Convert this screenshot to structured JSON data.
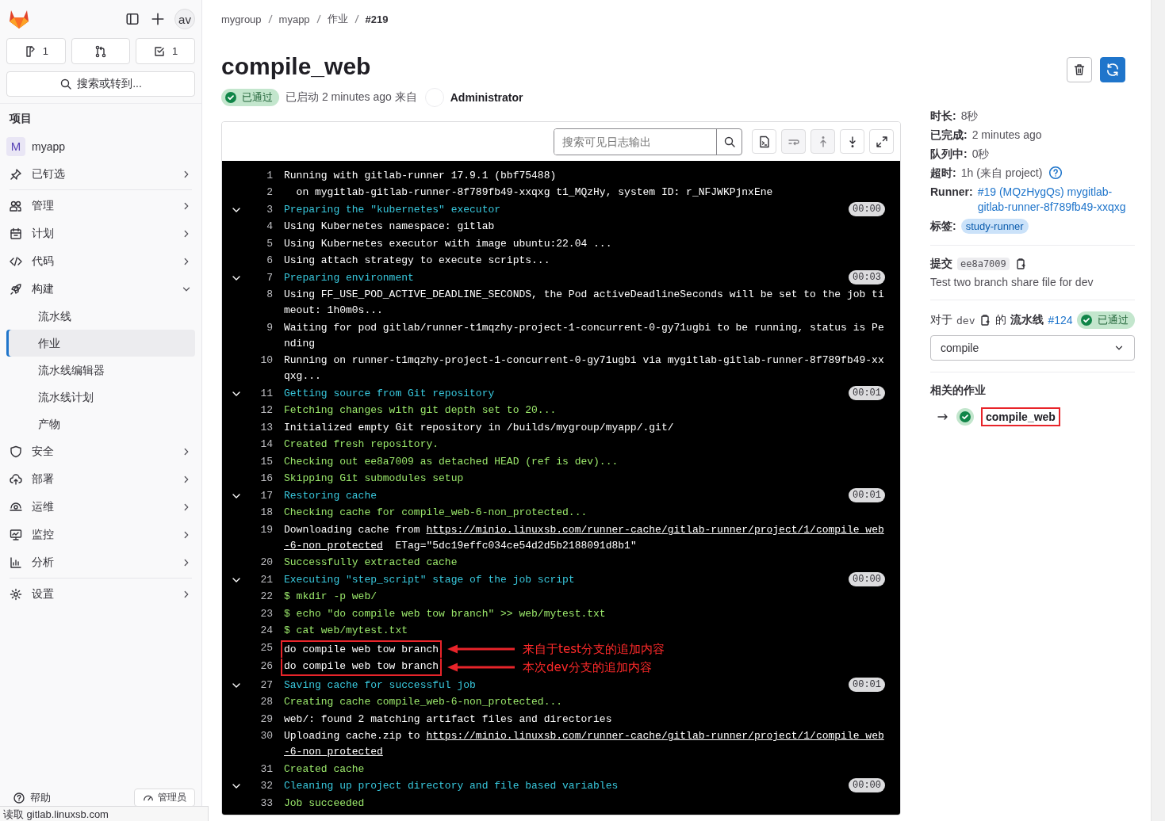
{
  "sidebar": {
    "avatar": "av",
    "counters": [
      {
        "kind": "issues",
        "count": "1"
      },
      {
        "kind": "merge_requests"
      },
      {
        "kind": "todos",
        "count": "1"
      }
    ],
    "search": "搜索或转到...",
    "section_title": "项目",
    "items": [
      {
        "kind": "project",
        "initial": "M",
        "label": "myapp"
      },
      {
        "kind": "menu",
        "label": "已钉选",
        "expanded": false
      },
      {
        "kind": "menu",
        "label": "管理",
        "expanded": false
      },
      {
        "kind": "menu",
        "label": "计划",
        "expanded": false
      },
      {
        "kind": "menu",
        "label": "代码",
        "expanded": false
      },
      {
        "kind": "menu",
        "label": "构建",
        "expanded": true,
        "children": [
          {
            "label": "流水线",
            "selected": false
          },
          {
            "label": "作业",
            "selected": true
          },
          {
            "label": "流水线编辑器",
            "selected": false
          },
          {
            "label": "流水线计划",
            "selected": false
          },
          {
            "label": "产物",
            "selected": false
          }
        ]
      },
      {
        "kind": "menu",
        "label": "安全",
        "expanded": false
      },
      {
        "kind": "menu",
        "label": "部署",
        "expanded": false
      },
      {
        "kind": "menu",
        "label": "运维",
        "expanded": false
      },
      {
        "kind": "menu",
        "label": "监控",
        "expanded": false
      },
      {
        "kind": "menu",
        "label": "分析",
        "expanded": false
      },
      {
        "kind": "menu",
        "label": "设置",
        "expanded": false
      }
    ],
    "help": "帮助",
    "admin": "管理员"
  },
  "breadcrumb": [
    "mygroup",
    "myapp",
    "作业",
    "#219"
  ],
  "job": {
    "title": "compile_web",
    "status": "已通过",
    "passed": true,
    "started": "已启动 2 minutes ago 来自",
    "user": "Administrator"
  },
  "log": {
    "search_placeholder": "搜索可见日志输出",
    "tools": [
      {
        "disabled": false
      },
      {
        "disabled": true
      },
      {
        "disabled": true
      },
      {
        "disabled": false
      },
      {
        "disabled": false
      }
    ],
    "lines": [
      {
        "n": "1",
        "kind": "plain",
        "text": "Running with gitlab-runner 17.9.1 (bbf75488)"
      },
      {
        "n": "2",
        "kind": "plain",
        "text": "  on mygitlab-gitlab-runner-8f789fb49-xxqxg t1_MQzHy, system ID: r_NFJWKPjnxEne"
      },
      {
        "n": "3",
        "kind": "section",
        "expanded": true,
        "duration": "00:00",
        "text": "Preparing the \"kubernetes\" executor"
      },
      {
        "n": "4",
        "kind": "plain",
        "text": "Using Kubernetes namespace: gitlab"
      },
      {
        "n": "5",
        "kind": "plain",
        "text": "Using Kubernetes executor with image ubuntu:22.04 ..."
      },
      {
        "n": "6",
        "kind": "plain",
        "text": "Using attach strategy to execute scripts..."
      },
      {
        "n": "7",
        "kind": "section",
        "expanded": true,
        "duration": "00:03",
        "text": "Preparing environment"
      },
      {
        "n": "8",
        "kind": "plain",
        "text": "Using FF_USE_POD_ACTIVE_DEADLINE_SECONDS, the Pod activeDeadlineSeconds will be set to the job timeout: 1h0m0s..."
      },
      {
        "n": "9",
        "kind": "plain",
        "text": "Waiting for pod gitlab/runner-t1mqzhy-project-1-concurrent-0-gy71ugbi to be running, status is Pending"
      },
      {
        "n": "10",
        "kind": "plain",
        "text": "Running on runner-t1mqzhy-project-1-concurrent-0-gy71ugbi via mygitlab-gitlab-runner-8f789fb49-xxqxg..."
      },
      {
        "n": "11",
        "kind": "section",
        "expanded": true,
        "duration": "00:01",
        "text": "Getting source from Git repository"
      },
      {
        "n": "12",
        "kind": "success",
        "text": "Fetching changes with git depth set to 20..."
      },
      {
        "n": "13",
        "kind": "plain",
        "text": "Initialized empty Git repository in /builds/mygroup/myapp/.git/"
      },
      {
        "n": "14",
        "kind": "success",
        "text": "Created fresh repository."
      },
      {
        "n": "15",
        "kind": "success",
        "text": "Checking out ee8a7009 as detached HEAD (ref is dev)..."
      },
      {
        "n": "16",
        "kind": "success",
        "text": "Skipping Git submodules setup"
      },
      {
        "n": "17",
        "kind": "section",
        "expanded": true,
        "duration": "00:01",
        "text": "Restoring cache"
      },
      {
        "n": "18",
        "kind": "success",
        "text": "Checking cache for compile_web-6-non_protected..."
      },
      {
        "n": "19",
        "kind": "plain",
        "text": "Downloading cache from ",
        "link": "https://minio.linuxsb.com/runner-cache/gitlab-runner/project/1/compile_web-6-non_protected",
        "after": "  ETag=\"5dc19effc034ce54d2d5b2188091d8b1\""
      },
      {
        "n": "20",
        "kind": "success",
        "text": "Successfully extracted cache"
      },
      {
        "n": "21",
        "kind": "section",
        "expanded": true,
        "duration": "00:00",
        "text": "Executing \"step_script\" stage of the job script"
      },
      {
        "n": "22",
        "kind": "success",
        "text": "$ mkdir -p web/"
      },
      {
        "n": "23",
        "kind": "success",
        "text": "$ echo \"do compile web tow branch\" >> web/mytest.txt"
      },
      {
        "n": "24",
        "kind": "success",
        "text": "$ cat web/mytest.txt"
      },
      {
        "n": "25",
        "kind": "plain",
        "boxed": true,
        "note": "来自于test分支的追加内容",
        "text": "do compile web tow branch"
      },
      {
        "n": "26",
        "kind": "plain",
        "boxed": true,
        "note": "本次dev分支的追加内容",
        "text": "do compile web tow branch"
      },
      {
        "n": "27",
        "kind": "section",
        "expanded": true,
        "duration": "00:01",
        "text": "Saving cache for successful job"
      },
      {
        "n": "28",
        "kind": "success",
        "text": "Creating cache compile_web-6-non_protected..."
      },
      {
        "n": "29",
        "kind": "plain",
        "text": "web/: found 2 matching artifact files and directories"
      },
      {
        "n": "30",
        "kind": "plain",
        "text": "Uploading cache.zip to ",
        "link": "https://minio.linuxsb.com/runner-cache/gitlab-runner/project/1/compile_web-6-non_protected"
      },
      {
        "n": "31",
        "kind": "success",
        "text": "Created cache"
      },
      {
        "n": "32",
        "kind": "section",
        "expanded": true,
        "duration": "00:00",
        "text": "Cleaning up project directory and file based variables"
      },
      {
        "n": "33",
        "kind": "success",
        "text": "Job succeeded"
      }
    ]
  },
  "details": {
    "rows": [
      {
        "kind": "text",
        "label": "时长:",
        "value": "8秒"
      },
      {
        "kind": "text",
        "label": "已完成:",
        "value": "2 minutes ago"
      },
      {
        "kind": "text",
        "label": "队列中:",
        "value": "0秒"
      },
      {
        "kind": "help",
        "label": "超时:",
        "value": "1h (来自 project)"
      },
      {
        "kind": "link",
        "label": "Runner:",
        "value": "#19 (MQzHygQs) mygitlab-gitlab-runner-8f789fb49-xxqxg"
      },
      {
        "kind": "tag",
        "label": "标签:",
        "value": "study-runner"
      }
    ],
    "commit": {
      "label": "提交",
      "sha": "ee8a7009",
      "message": "Test two branch share file for dev"
    },
    "pipeline": {
      "prefix": "对于",
      "ref": "dev",
      "of": "的",
      "label": "流水线",
      "number": "#124",
      "status": "已通过",
      "passed": true
    },
    "stage": "compile",
    "related_title": "相关的作业",
    "related": [
      {
        "name": "compile_web",
        "passed": true,
        "boxed": true
      }
    ]
  },
  "status_bar": "读取 gitlab.linuxsb.com"
}
